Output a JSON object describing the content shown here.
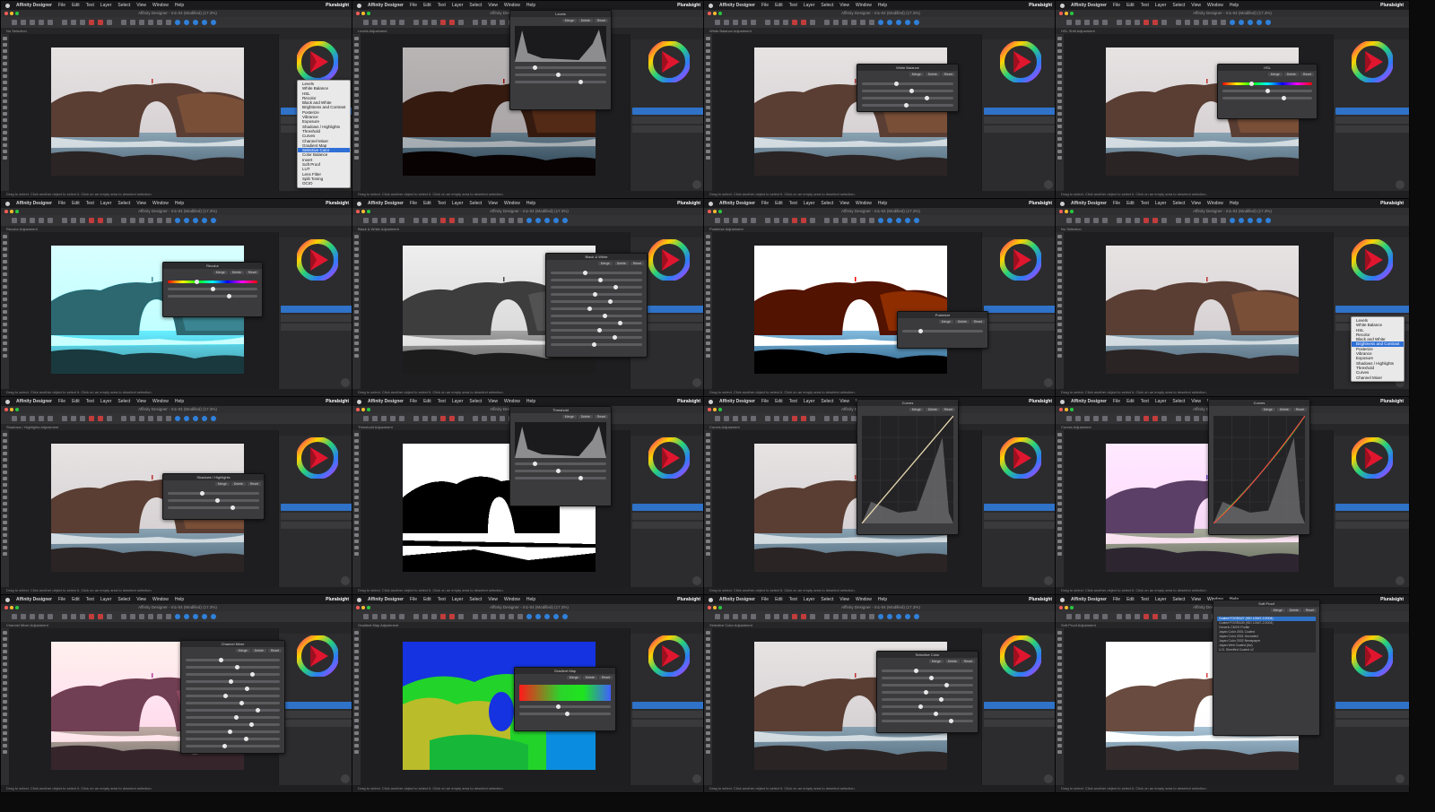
{
  "screen": {
    "app_name": "Affinity Designer",
    "menus": [
      "File",
      "Edit",
      "Text",
      "Layer",
      "Select",
      "View",
      "Window",
      "Help"
    ],
    "brand": "Pluralsight",
    "window_title": "Affinity Designer - m1-04 (Modified) (17.3%)",
    "status_hint": "Drag to select. Click another object to select it. Click on an empty area to deselect selection."
  },
  "colors": {
    "accent_blue": "#2f72c8",
    "menubar_bg": "#1b1b1d",
    "panel_bg": "#3b3b3e",
    "traffic_red": "#ff5f57",
    "traffic_yellow": "#febc2e",
    "traffic_green": "#28c840"
  },
  "adjustment_menu_items": [
    "Levels",
    "White Balance",
    "HSL",
    "Recolor",
    "Black and White",
    "Brightness and Contrast",
    "Posterize",
    "Vibrance",
    "Exposure",
    "Shadows / Highlights",
    "Threshold",
    "Curves",
    "Channel Mixer",
    "Gradient Map",
    "Selective Color",
    "Color Balance",
    "Invert",
    "Soft Proof",
    "LUT",
    "Lens Filter",
    "Split Toning",
    "OCIO"
  ],
  "adjustment_menu_selected": "Selective Color",
  "adjustment_menu_short": [
    "Levels",
    "White Balance",
    "HSL",
    "Recolor",
    "Black and White",
    "Brightness and Contrast",
    "Posterize",
    "Vibrance",
    "Exposure",
    "Shadows / Highlights",
    "Threshold",
    "Curves",
    "Channel Mixer"
  ],
  "adjustment_menu_short_selected": "Brightness and Contrast",
  "tiles": [
    {
      "context": "No Selection",
      "panel": "menu",
      "photo": "natural",
      "panel_title": ""
    },
    {
      "context": "Levels Adjustment",
      "panel": "levels",
      "photo": "dark",
      "panel_title": "Levels"
    },
    {
      "context": "White Balance Adjustment",
      "panel": "sliders",
      "photo": "natural",
      "panel_title": "White Balance"
    },
    {
      "context": "HSL Shift Adjustment",
      "panel": "hsl",
      "photo": "natural",
      "panel_title": "HSL"
    },
    {
      "context": "Recolor Adjustment",
      "panel": "hsl",
      "photo": "teal",
      "panel_title": "Recolor"
    },
    {
      "context": "Black & White Adjustment",
      "panel": "sliders",
      "photo": "mono",
      "panel_title": "Black & White"
    },
    {
      "context": "Posterize Adjustment",
      "panel": "small",
      "photo": "poster",
      "panel_title": "Posterize"
    },
    {
      "context": "No Selection",
      "panel": "menu2",
      "photo": "natural",
      "panel_title": ""
    },
    {
      "context": "Shadows / Highlights Adjustment",
      "panel": "sliders",
      "photo": "natural",
      "panel_title": "Shadows / Highlights"
    },
    {
      "context": "Threshold Adjustment",
      "panel": "levels",
      "photo": "threshold",
      "panel_title": "Threshold"
    },
    {
      "context": "Curves Adjustment",
      "panel": "curves",
      "photo": "natural",
      "panel_title": "Curves"
    },
    {
      "context": "Curves Adjustment",
      "panel": "curves2",
      "photo": "pinkish",
      "panel_title": "Curves"
    },
    {
      "context": "Channel Mixer Adjustment",
      "panel": "sliders",
      "photo": "pink",
      "panel_title": "Channel Mixer"
    },
    {
      "context": "Gradient Map Adjustment",
      "panel": "gradient",
      "photo": "gradmap",
      "panel_title": "Gradient Map"
    },
    {
      "context": "Selective Color Adjustment",
      "panel": "sliders",
      "photo": "natural",
      "panel_title": "Selective Color"
    },
    {
      "context": "Soft Proof Adjustment",
      "panel": "list",
      "photo": "bright",
      "panel_title": "Soft Proof"
    }
  ],
  "panel_buttons": [
    "Merge",
    "Delete",
    "Reset"
  ],
  "profile_list": [
    "Coated FOGRA27 (ISO 12647-2:2004)",
    "Coated FOGRA39 (ISO 12647-2:2004)",
    "Generic CMYK Profile",
    "Japan Color 2001 Coated",
    "Japan Color 2001 Uncoated",
    "Japan Color 2002 Newspaper",
    "Japan Web Coated (Ad)",
    "U.S. Sheetfed Coated v2"
  ]
}
